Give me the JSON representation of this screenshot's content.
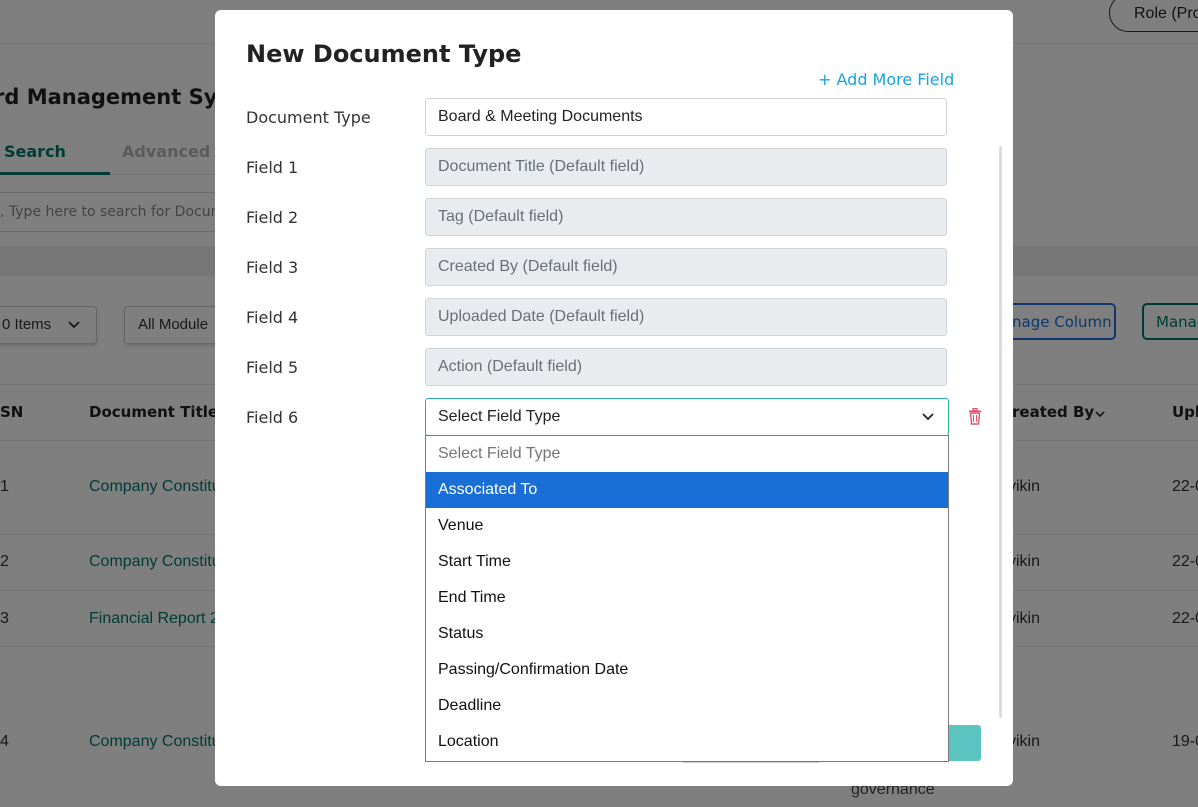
{
  "background": {
    "role_button": "Role (Pro",
    "app_title": "rd Management Syst",
    "tabs": {
      "search": "Search",
      "advanced": "Advanced Se"
    },
    "search_placeholder": ", Type here to search for Docum",
    "items_dropdown": "0 Items",
    "modules_dropdown": "All Module",
    "manage_column_button": "nage Column",
    "manage_button": "Manag",
    "table": {
      "headers": {
        "sn": "SN",
        "title": "Document Title",
        "created_by": "reated By",
        "uploaded": "Upl"
      },
      "rows": [
        {
          "sn": "1",
          "title": "Company Constitu",
          "created_by": "yikin",
          "uploaded": "22-0"
        },
        {
          "sn": "2",
          "title": "Company Constitu",
          "created_by": "yikin",
          "uploaded": "22-0"
        },
        {
          "sn": "3",
          "title": "Financial Report 2",
          "created_by": "yikin",
          "uploaded": "22-0"
        },
        {
          "sn": "4",
          "title": "Company Constitu",
          "created_by": "yikin",
          "uploaded": "19-0"
        }
      ],
      "extra_text": "governance"
    }
  },
  "modal": {
    "title": "New Document Type",
    "add_more_field": "+ Add More Field",
    "document_type": {
      "label": "Document Type",
      "value": "Board & Meeting Documents"
    },
    "fields": [
      {
        "label": "Field 1",
        "value": "Document Title (Default field)"
      },
      {
        "label": "Field 2",
        "value": "Tag (Default field)"
      },
      {
        "label": "Field 3",
        "value": "Created By (Default field)"
      },
      {
        "label": "Field 4",
        "value": "Uploaded Date (Default field)"
      },
      {
        "label": "Field 5",
        "value": "Action (Default field)"
      }
    ],
    "field6": {
      "label": "Field 6",
      "selected": "Select Field Type"
    },
    "dropdown_options": [
      "Select Field Type",
      "Associated To",
      "Venue",
      "Start Time",
      "End Time",
      "Status",
      "Passing/Confirmation Date",
      "Deadline",
      "Location"
    ],
    "highlighted_option": "Associated To"
  },
  "colors": {
    "overlay": "#000000",
    "teal": "#00796b",
    "link_blue": "#1aa3e0",
    "highlight_blue": "#1a6fd6",
    "trash_red": "#e0566b"
  },
  "icons": [
    "chevron-down-icon",
    "trash-icon"
  ]
}
